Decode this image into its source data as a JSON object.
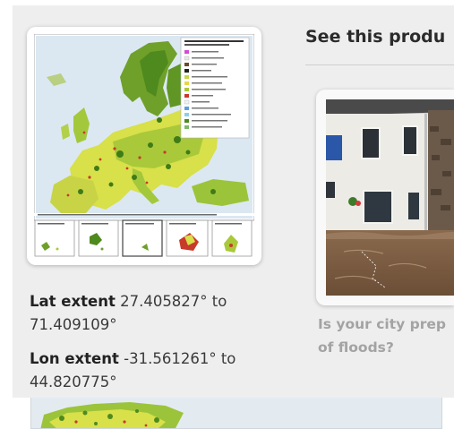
{
  "product": {
    "lat_extent_label": "Lat extent",
    "lat_extent_value_line1": "27.405827° to",
    "lat_extent_value_line2": "71.409109°",
    "lon_extent_label": "Lon extent",
    "lon_extent_value_line1": "-31.561261° to",
    "lon_extent_value_line2": "44.820775°"
  },
  "sidebar": {
    "title": "See this produ",
    "article": {
      "caption_line1": "Is your city prep",
      "caption_line2": "of floods?"
    }
  },
  "colors": {
    "panel_bg": "#eeeeee",
    "sea": "#dbe8f2",
    "land_green": "#6fa02a",
    "land_yellow": "#d8e04a",
    "urban_red": "#c83a2a",
    "caption_grey": "#a3a3a3"
  }
}
